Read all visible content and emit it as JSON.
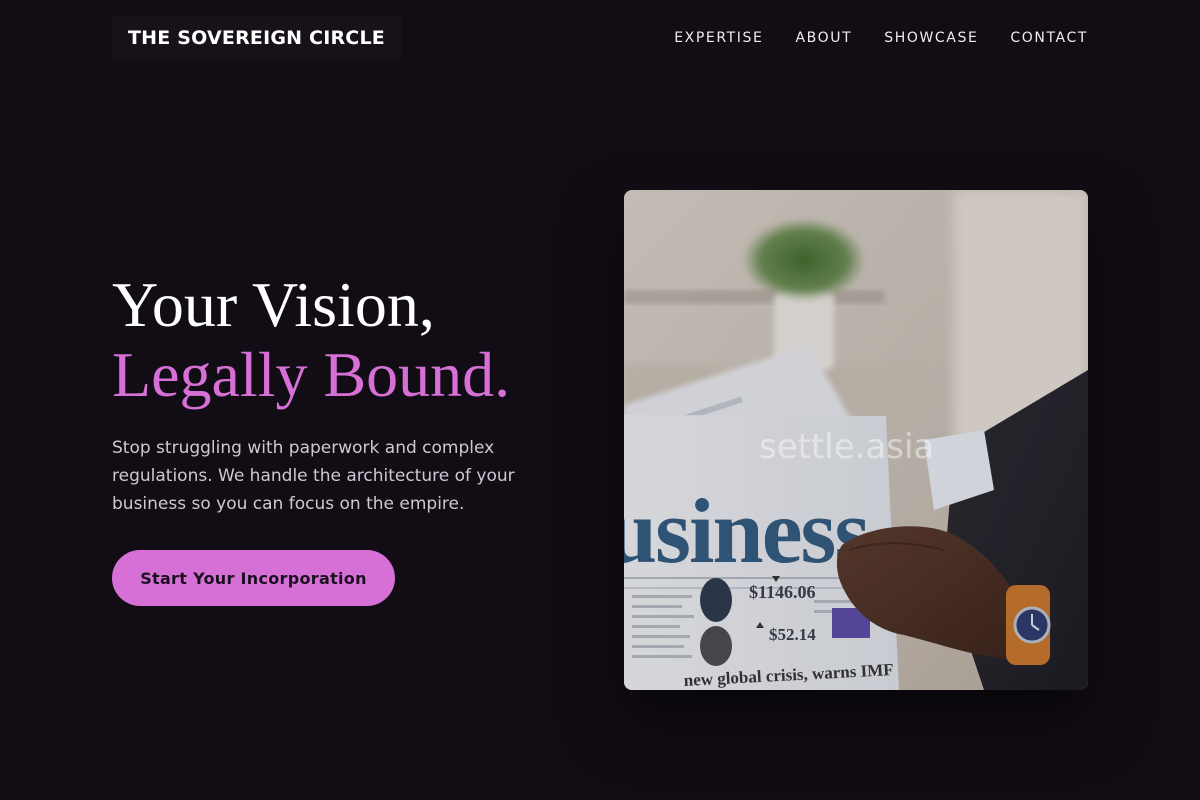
{
  "brand": {
    "name": "THE SOVEREIGN CIRCLE"
  },
  "nav": {
    "items": [
      {
        "label": "EXPERTISE"
      },
      {
        "label": "ABOUT"
      },
      {
        "label": "SHOWCASE"
      },
      {
        "label": "CONTACT"
      }
    ]
  },
  "hero": {
    "headline_line1": "Your Vision,",
    "headline_line2": "Legally Bound.",
    "subtext": "Stop struggling with paperwork and complex regulations. We handle the architecture of your business so you can focus on the empire.",
    "cta_label": "Start Your Incorporation"
  },
  "image": {
    "newspaper_masthead": "usiness",
    "price_1": "$1146.06",
    "price_2": "$52.14",
    "headline_snippet": "new global crisis, warns IMF",
    "watermark": "settle.asia"
  },
  "colors": {
    "background": "#120d15",
    "accent": "#d670d6",
    "text_primary": "#ffffff",
    "text_muted": "#cfc8d2"
  }
}
